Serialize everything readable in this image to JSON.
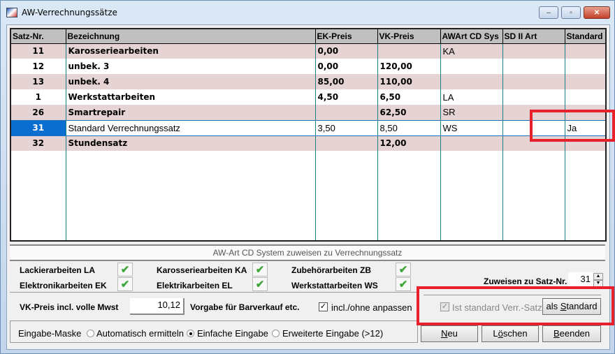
{
  "window": {
    "title": "AW-Verrechnungssätze",
    "controls": {
      "minimize": "–",
      "maximize": "▫",
      "close": "✕"
    }
  },
  "grid": {
    "columns": [
      "Satz-Nr.",
      "Bezeichnung",
      "EK-Preis",
      "VK-Preis",
      "AWArt CD Sys",
      "SD II Art",
      "Standard"
    ],
    "rows": [
      {
        "satz": "11",
        "bez": "Karosseriearbeiten",
        "ek": "0,00",
        "vk": "",
        "awart": "KA",
        "sd": "",
        "std": ""
      },
      {
        "satz": "12",
        "bez": "unbek. 3",
        "ek": "0,00",
        "vk": "120,00",
        "awart": "",
        "sd": "",
        "std": ""
      },
      {
        "satz": "13",
        "bez": "unbek. 4",
        "ek": "85,00",
        "vk": "110,00",
        "awart": "",
        "sd": "",
        "std": ""
      },
      {
        "satz": "1",
        "bez": "Werkstattarbeiten",
        "ek": "4,50",
        "vk": "6,50",
        "awart": "LA",
        "sd": "",
        "std": ""
      },
      {
        "satz": "26",
        "bez": "Smartrepair",
        "ek": "",
        "vk": "62,50",
        "awart": "SR",
        "sd": "",
        "std": ""
      },
      {
        "satz": "31",
        "bez": "Standard Verrechnungssatz",
        "ek": "3,50",
        "vk": "8,50",
        "awart": "WS",
        "sd": "",
        "std": "Ja"
      },
      {
        "satz": "32",
        "bez": "Stundensatz",
        "ek": "",
        "vk": "12,00",
        "awart": "",
        "sd": "",
        "std": ""
      }
    ],
    "selected_row": 5
  },
  "assign": {
    "header": "AW-Art CD System zuweisen zu Verrechnungssatz",
    "categories": [
      {
        "label": "Lackierarbeiten LA",
        "checked": true
      },
      {
        "label": "Elektronikarbeiten EK",
        "checked": true
      },
      {
        "label": "Karosseriearbeiten KA",
        "checked": true
      },
      {
        "label": "Elektrikarbeiten EL",
        "checked": true
      },
      {
        "label": "Zubehörarbeiten ZB",
        "checked": true
      },
      {
        "label": "Werkstattarbeiten WS",
        "checked": true
      }
    ],
    "check_icon": "✔",
    "assign_label": "Zuweisen zu Satz-Nr.",
    "assign_value": "31",
    "spin_up": "▲",
    "spin_down": "▼"
  },
  "price": {
    "label": "VK-Preis incl. volle Mwst",
    "value": "10,12",
    "vorgabe_label": "Vorgabe für Barverkauf etc.",
    "incl_label": "incl./ohne anpassen",
    "incl_checked": true,
    "check_mark": "✓"
  },
  "standard": {
    "is_standard_label": "Ist standard Verr.-Satz",
    "is_standard_checked": true,
    "als_standard_prefix": "als ",
    "als_standard_hotkey": "S",
    "als_standard_rest": "tandard"
  },
  "mask": {
    "label": "Eingabe-Maske",
    "options": [
      {
        "label": "Automatisch ermitteln",
        "selected": false
      },
      {
        "label": "Einfache Eingabe",
        "selected": true
      },
      {
        "label": "Erweiterte Eingabe (>12)",
        "selected": false
      }
    ]
  },
  "buttons": {
    "neu_hot": "N",
    "neu_rest": "eu",
    "loeschen_pre": "L",
    "loeschen_hot": "ö",
    "loeschen_rest": "schen",
    "beenden_hot": "B",
    "beenden_rest": "eenden"
  }
}
